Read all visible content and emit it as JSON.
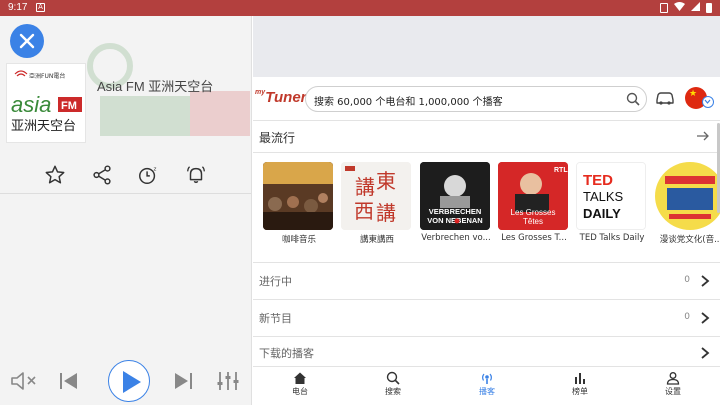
{
  "status_bar": {
    "time": "9:17"
  },
  "player": {
    "station_name": "Asia FM 亚洲天空台",
    "logo": {
      "small_text": "亞洲FUN電台",
      "brand": "asia",
      "badge": "FM",
      "subtitle": "亚洲天空台"
    }
  },
  "header": {
    "brand": "Tuner",
    "search_placeholder": "搜索 60,000 个电台和 1,000,000 个播客"
  },
  "popular": {
    "title": "最流行",
    "items": [
      {
        "caption": "咖啡音乐",
        "thumb_text": ""
      },
      {
        "caption": "講東講西",
        "thumb_text": "講東西講"
      },
      {
        "caption": "Verbrechen vo...",
        "thumb_text": "VERBRECHEN VON NEBENAN"
      },
      {
        "caption": "Les Grosses T...",
        "thumb_text": "Les Grosses Têtes"
      },
      {
        "caption": "TED Talks Daily",
        "thumb_text": "TED TALKS DAILY"
      },
      {
        "caption": "漫谈党文化(音...",
        "thumb_text": ""
      }
    ]
  },
  "rows": [
    {
      "label": "进行中",
      "count": "0"
    },
    {
      "label": "新节目",
      "count": "0"
    },
    {
      "label": "下载的播客",
      "count": ""
    }
  ],
  "tabs": [
    {
      "label": "电台",
      "icon": "home-icon"
    },
    {
      "label": "搜索",
      "icon": "search-icon"
    },
    {
      "label": "播客",
      "icon": "podcast-icon"
    },
    {
      "label": "榜单",
      "icon": "chart-icon"
    },
    {
      "label": "设置",
      "icon": "user-icon"
    }
  ],
  "colors": {
    "accent": "#3b82e6",
    "status_bar": "#b3403e",
    "brand_red": "#c0392b"
  }
}
